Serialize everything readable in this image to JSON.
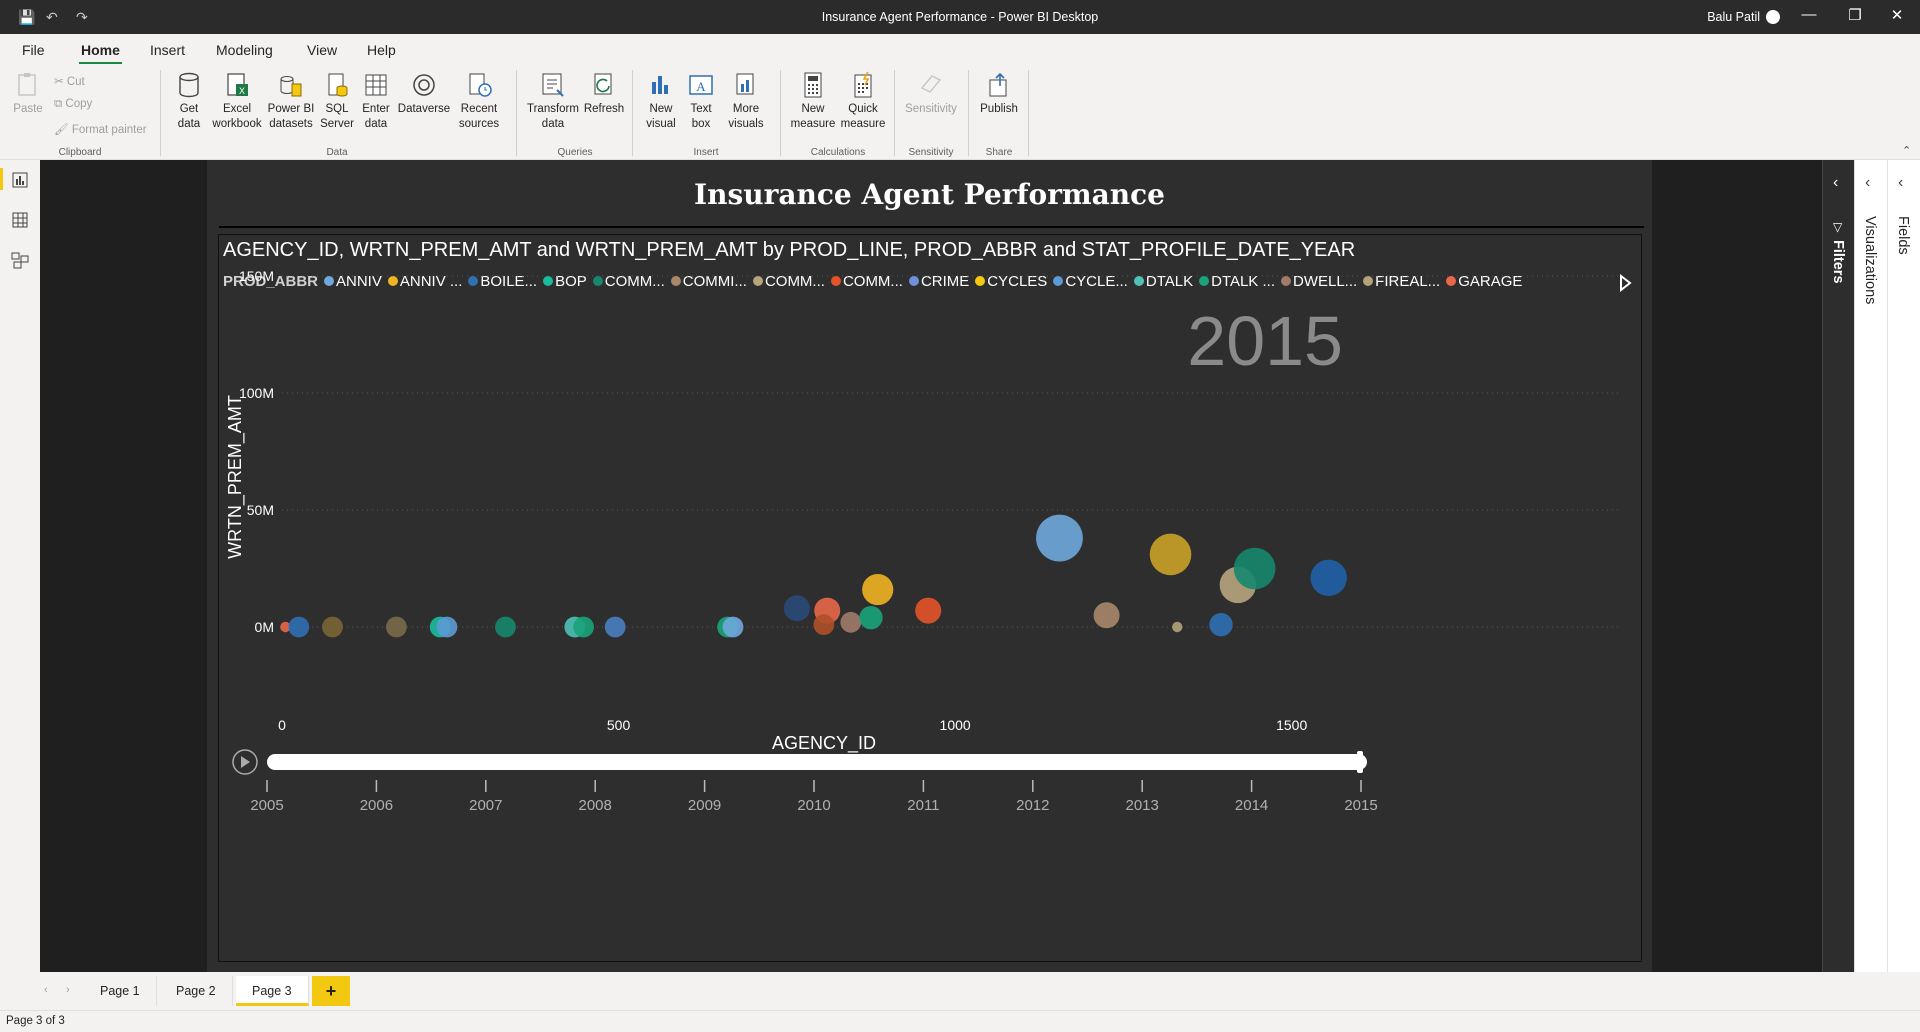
{
  "titlebar": {
    "title": "Insurance Agent Performance - Power BI Desktop",
    "user": "Balu Patil",
    "minimize_icon": "minimize-icon",
    "restore_icon": "restore-icon",
    "close_icon": "close-icon"
  },
  "menu": {
    "tabs": [
      "File",
      "Home",
      "Insert",
      "Modeling",
      "View",
      "Help"
    ],
    "active": "Home"
  },
  "ribbon": {
    "clipboard": {
      "paste": "Paste",
      "cut": "Cut",
      "copy": "Copy",
      "format_painter": "Format painter",
      "group": "Clipboard"
    },
    "data": {
      "get_data": "Get data",
      "excel": "Excel workbook",
      "pbi_datasets": "Power BI datasets",
      "sql": "SQL Server",
      "enter_data": "Enter data",
      "dataverse": "Dataverse",
      "recent": "Recent sources",
      "group": "Data"
    },
    "queries": {
      "transform": "Transform data",
      "refresh": "Refresh",
      "group": "Queries"
    },
    "insert": {
      "new_visual": "New visual",
      "text_box": "Text box",
      "more_visuals": "More visuals",
      "group": "Insert"
    },
    "calculations": {
      "new_measure": "New measure",
      "quick_measure": "Quick measure",
      "group": "Calculations"
    },
    "sensitivity": {
      "sensitivity": "Sensitivity",
      "group": "Sensitivity"
    },
    "share": {
      "publish": "Publish",
      "group": "Share"
    }
  },
  "report": {
    "title": "Insurance Agent Performance"
  },
  "visual": {
    "title": "AGENCY_ID, WRTN_PREM_AMT and WRTN_PREM_AMT by PROD_LINE, PROD_ABBR and STAT_PROFILE_DATE_YEAR",
    "legend_title": "PROD_ABBR",
    "legend": [
      {
        "label": "ANNIV",
        "color": "#6fa8dc"
      },
      {
        "label": "ANNIV ...",
        "color": "#f0b323"
      },
      {
        "label": "BOILE...",
        "color": "#2f6fb3"
      },
      {
        "label": "BOP",
        "color": "#1abc9c"
      },
      {
        "label": "COMM...",
        "color": "#16876d"
      },
      {
        "label": "COMMI...",
        "color": "#a9876a"
      },
      {
        "label": "COMM...",
        "color": "#b8a57e"
      },
      {
        "label": "COMM...",
        "color": "#e5532a"
      },
      {
        "label": "CRIME",
        "color": "#6f8fd8"
      },
      {
        "label": "CYCLES",
        "color": "#f2c811"
      },
      {
        "label": "CYCLE...",
        "color": "#5b9bd5"
      },
      {
        "label": "DTALK",
        "color": "#4fc1b5"
      },
      {
        "label": "DTALK ...",
        "color": "#1aa37a"
      },
      {
        "label": "DWELL...",
        "color": "#a07a6a"
      },
      {
        "label": "FIREAL...",
        "color": "#b5a27a"
      },
      {
        "label": "GARAGE",
        "color": "#e8684a"
      }
    ],
    "play_axis": {
      "years": [
        "2005",
        "2006",
        "2007",
        "2008",
        "2009",
        "2010",
        "2011",
        "2012",
        "2013",
        "2014",
        "2015"
      ],
      "current": "2015"
    }
  },
  "chart_data": {
    "type": "scatter",
    "title": "AGENCY_ID, WRTN_PREM_AMT and WRTN_PREM_AMT by PROD_LINE, PROD_ABBR and STAT_PROFILE_DATE_YEAR",
    "xlabel": "AGENCY_ID",
    "ylabel": "WRTN_PREM_AMT",
    "xlim": [
      0,
      1600
    ],
    "ylim": [
      0,
      150
    ],
    "x_ticks": [
      "0",
      "500",
      "1000",
      "1500"
    ],
    "y_ticks": [
      "0M",
      "50M",
      "100M",
      "150M"
    ],
    "year_label": "2015",
    "points": [
      {
        "x": 5,
        "y": 0,
        "s": 2,
        "color": "#e8684a"
      },
      {
        "x": 25,
        "y": 0,
        "s": 4,
        "color": "#2f6fb3"
      },
      {
        "x": 75,
        "y": 0,
        "s": 4,
        "color": "#7a6535"
      },
      {
        "x": 170,
        "y": 0,
        "s": 4,
        "color": "#7a6a4a"
      },
      {
        "x": 235,
        "y": 0,
        "s": 4,
        "color": "#1abc9c"
      },
      {
        "x": 245,
        "y": 0,
        "s": 4,
        "color": "#5b9bd5"
      },
      {
        "x": 332,
        "y": 0,
        "s": 4,
        "color": "#16876d"
      },
      {
        "x": 435,
        "y": 0,
        "s": 4,
        "color": "#4fc1b5"
      },
      {
        "x": 448,
        "y": 0,
        "s": 4,
        "color": "#1aa37a"
      },
      {
        "x": 495,
        "y": 0,
        "s": 4,
        "color": "#4a7fc1"
      },
      {
        "x": 662,
        "y": 0,
        "s": 4,
        "color": "#1aa37a"
      },
      {
        "x": 670,
        "y": 0,
        "s": 4,
        "color": "#6fa8dc"
      },
      {
        "x": 765,
        "y": 8,
        "s": 5,
        "color": "#2a4a7a"
      },
      {
        "x": 810,
        "y": 7,
        "s": 5,
        "color": "#e8684a"
      },
      {
        "x": 805,
        "y": 1,
        "s": 4,
        "color": "#b0502a"
      },
      {
        "x": 845,
        "y": 2,
        "s": 4,
        "color": "#a07a6a"
      },
      {
        "x": 875,
        "y": 4,
        "s": 4.5,
        "color": "#1aa37a"
      },
      {
        "x": 885,
        "y": 16,
        "s": 6,
        "color": "#f0b323"
      },
      {
        "x": 960,
        "y": 7,
        "s": 5,
        "color": "#e5532a"
      },
      {
        "x": 1155,
        "y": 38,
        "s": 9,
        "color": "#6fa8dc"
      },
      {
        "x": 1225,
        "y": 5,
        "s": 5,
        "color": "#a9876a"
      },
      {
        "x": 1320,
        "y": 31,
        "s": 8,
        "color": "#c9a227"
      },
      {
        "x": 1330,
        "y": 0,
        "s": 2,
        "color": "#b5a27a"
      },
      {
        "x": 1395,
        "y": 1,
        "s": 4.5,
        "color": "#2f6fb3"
      },
      {
        "x": 1420,
        "y": 18,
        "s": 7,
        "color": "#b8a57e"
      },
      {
        "x": 1445,
        "y": 25,
        "s": 8,
        "color": "#16876d"
      },
      {
        "x": 1555,
        "y": 21,
        "s": 7,
        "color": "#2060a8"
      }
    ]
  },
  "panes": {
    "filters": "Filters",
    "visualizations": "Visualizations",
    "fields": "Fields"
  },
  "pages": {
    "tabs": [
      "Page 1",
      "Page 2",
      "Page 3"
    ],
    "active": "Page 3",
    "add": "+"
  },
  "status": {
    "text": "Page 3 of 3"
  }
}
